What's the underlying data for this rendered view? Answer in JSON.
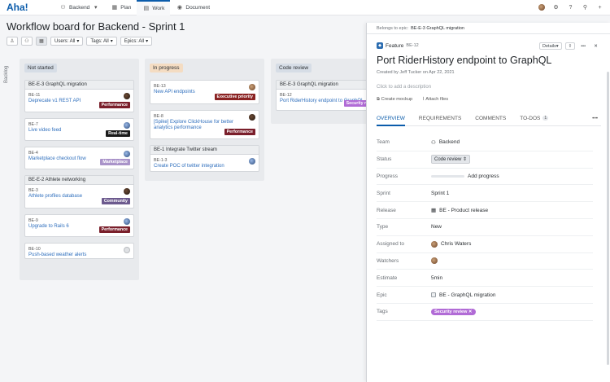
{
  "app": {
    "logo": "Aha!"
  },
  "topnav": {
    "workspace": "Backend",
    "items": [
      {
        "label": "Plan"
      },
      {
        "label": "Work"
      },
      {
        "label": "Document"
      }
    ]
  },
  "page": {
    "title": "Workflow board for Backend - Sprint 1"
  },
  "toolbar": {
    "users": "Users: All",
    "tags": "Tags: All",
    "epics": "Epics: All"
  },
  "backlog": {
    "label": "Backlog"
  },
  "columns": {
    "not_started": {
      "label": "Not started",
      "g1": {
        "title": "BE-E-3 GraphQL migration",
        "c1": {
          "id": "BE-11",
          "title": "Deprecate v1 REST API",
          "tag": "Performance"
        }
      },
      "c2": {
        "id": "BE-7",
        "title": "Live video feed",
        "tag": "Real-time"
      },
      "c3": {
        "id": "BE-4",
        "title": "Marketplace checkout flow",
        "tag": "Marketplace"
      },
      "g2": {
        "title": "BE-E-2 Athlete networking",
        "c1": {
          "id": "BE-3",
          "title": "Athlete profiles database",
          "tag": "Community"
        }
      },
      "c4": {
        "id": "BE-9",
        "title": "Upgrade to Rails 6",
        "tag": "Performance"
      },
      "c5": {
        "id": "BE-10",
        "title": "Push-based weather alerts"
      }
    },
    "in_progress": {
      "label": "In progress",
      "c1": {
        "id": "BE-13",
        "title": "New API endpoints",
        "tag": "Executive priority"
      },
      "c2": {
        "id": "BE-8",
        "title": "[Spike] Explore ClickHouse for better analytics performance",
        "tag": "Performance"
      },
      "g1": {
        "title": "BE-1 Integrate Twitter stream",
        "c1": {
          "id": "BE-1-3",
          "title": "Create POC of twitter integration"
        }
      }
    },
    "code_review": {
      "label": "Code review",
      "g1": {
        "title": "BE-E-3 GraphQL migration",
        "c1": {
          "id": "BE-12",
          "title": "Port RiderHistory endpoint to GraphQL",
          "tag": "Security re"
        }
      }
    }
  },
  "panel": {
    "belongs_label": "Belongs to epic:",
    "belongs_value": "BE-E-3 GraphQL migration",
    "type_label": "Feature",
    "id": "BE-12",
    "details_btn": "Details",
    "title": "Port RiderHistory endpoint to GraphQL",
    "created": "Created by Jeff Tucker on Apr 22, 2021",
    "desc_placeholder": "Click to add a description",
    "create_mockup": "Create mockup",
    "attach_files": "Attach files",
    "tabs": {
      "overview": "OVERVIEW",
      "requirements": "REQUIREMENTS",
      "comments": "COMMENTS",
      "todos": "TO-DOS",
      "todos_count": "1"
    },
    "fields": {
      "team": {
        "label": "Team",
        "value": "Backend"
      },
      "status": {
        "label": "Status",
        "value": "Code review"
      },
      "progress": {
        "label": "Progress",
        "value": "Add progress"
      },
      "sprint": {
        "label": "Sprint",
        "value": "Sprint 1"
      },
      "release": {
        "label": "Release",
        "value": "BE - Product release"
      },
      "type": {
        "label": "Type",
        "value": "New"
      },
      "assigned": {
        "label": "Assigned to",
        "value": "Chris Waters"
      },
      "watchers": {
        "label": "Watchers"
      },
      "estimate": {
        "label": "Estimate",
        "value": "5min"
      },
      "epic": {
        "label": "Epic",
        "value": "BE - GraphQL migration"
      },
      "tags": {
        "label": "Tags",
        "value": "Security review"
      }
    }
  },
  "colors": {
    "performance": "#7a1f2b",
    "realtime": "#1a1a1a",
    "marketplace": "#a993c9",
    "community": "#6c5a8e",
    "executive": "#8a2222",
    "security": "#b16bd6",
    "accent": "#0b5cab"
  }
}
